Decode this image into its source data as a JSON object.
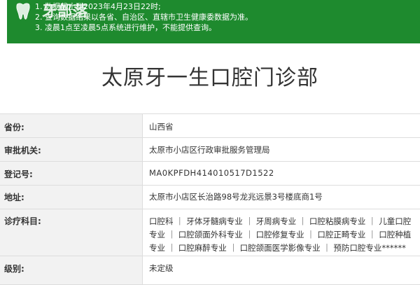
{
  "notice": {
    "logo_text": "牙部落",
    "lines": [
      "1. 数据截止到2023年4月23日22时;",
      "2. 查询数据结果以各省、自治区、直辖市卫生健康委数据为准。",
      "3. 凌晨1点至凌晨5点系统进行维护，不能提供查询。"
    ]
  },
  "page": {
    "title": "太原牙一生口腔门诊部"
  },
  "info": {
    "province_label": "省份:",
    "province": "山西省",
    "authority_label": "审批机关:",
    "authority": "太原市小店区行政审批服务管理局",
    "reg_label": "登记号:",
    "reg_no": "MA0KPFDH414010517D1522",
    "address_label": "地址:",
    "address": "太原市小店区长治路98号龙兆远景3号楼底商1号",
    "subjects_label": "诊疗科目:",
    "subjects": "口腔科 ｜ 牙体牙髓病专业 ｜ 牙周病专业 ｜ 口腔粘膜病专业 ｜ 儿童口腔专业 ｜ 口腔颌面外科专业 ｜ 口腔修复专业 ｜ 口腔正畸专业 ｜ 口腔种植专业 ｜ 口腔麻醉专业 ｜ 口腔颌面医学影像专业 ｜ 预防口腔专业******",
    "level_label": "级别:",
    "level": "未定级"
  },
  "colors": {
    "banner": "#1e8a2e",
    "label_bg": "#f2f2f2",
    "border": "#dddddd"
  }
}
